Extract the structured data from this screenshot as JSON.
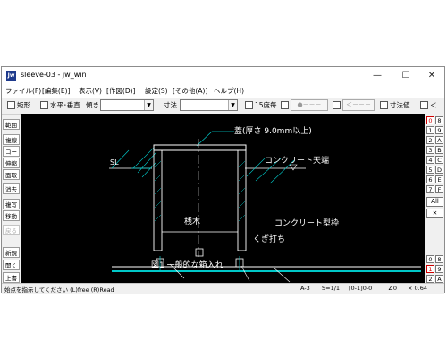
{
  "window": {
    "title": "sleeve-03 - jw_win",
    "icon_label": "Jw"
  },
  "window_buttons": {
    "minimize": "—",
    "maximize": "☐",
    "close": "✕"
  },
  "menu": [
    "ファイル(F)",
    "[編集(E)]",
    "表示(V)",
    "[作図(D)]",
    "設定(S)",
    "[その他(A)]",
    "ヘルプ(H)"
  ],
  "toolbar": {
    "rect_label": "矩形",
    "hv_label": "水平･垂直",
    "tilt_label": "傾き",
    "tilt_value": "",
    "dim_label": "寸法",
    "dim_value": "",
    "deg15_label": "15度毎",
    "dash_button": "●－－－",
    "arrow_button": "＜－－－",
    "dimval_label": "寸法値",
    "lt_label": "＜"
  },
  "left_tools": [
    "範囲",
    "複線",
    "コーナー",
    "伸縮",
    "面取",
    "消去",
    "複写",
    "移動",
    "戻る",
    "新規",
    "開く",
    "上書"
  ],
  "right_layers": {
    "left_col": [
      "0",
      "1",
      "2",
      "3",
      "4",
      "5",
      "6",
      "7"
    ],
    "right_col": [
      "8",
      "9",
      "A",
      "B",
      "C",
      "D",
      "E",
      "F"
    ],
    "all_label": "All",
    "x_label": "✕",
    "bottom_left": [
      "0",
      "1",
      "2"
    ],
    "bottom_right": [
      "8",
      "9",
      "A"
    ]
  },
  "drawing": {
    "label_lid": "蓋(厚さ 9.0mm以上)",
    "label_concrete_top": "コンクリート天端",
    "label_sl": "SL",
    "label_sankaku": "桟木",
    "label_formwork": "コンクリート型枠",
    "label_nail": "くぎ打ち",
    "caption": "図1  一般的な箱入れ"
  },
  "status": {
    "message": "始点を指示してください (L)free (R)Read",
    "paper": "A-3",
    "scale": "S=1/1",
    "layer": "[0-1]0-0",
    "angle": "∠0",
    "zoom": "× 0.64"
  },
  "colors": {
    "canvas_bg": "#000000",
    "cyan": "#00c8c8",
    "white": "#ffffff",
    "red_accent": "#d00000"
  }
}
